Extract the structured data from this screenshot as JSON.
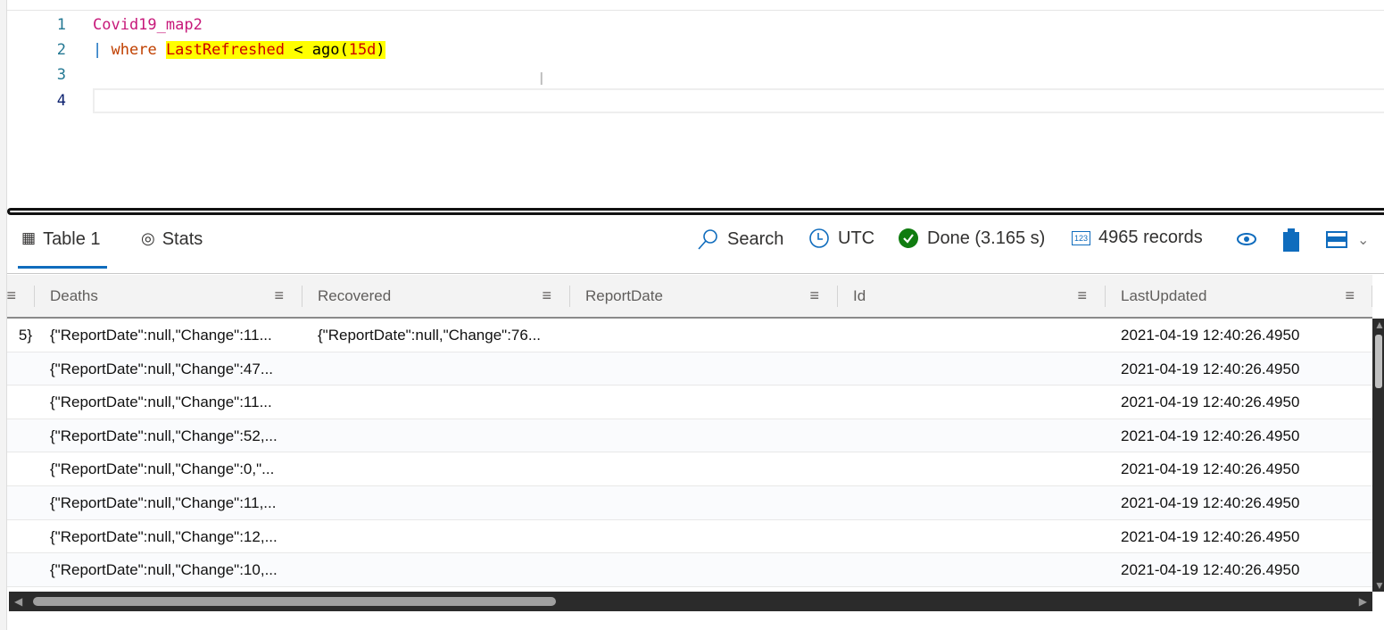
{
  "editor": {
    "lines": [
      {
        "number": "1",
        "table": "Covid19_map2"
      },
      {
        "number": "2",
        "pipe": "|",
        "keyword": "where",
        "column": "LastRefreshed",
        "op": "<",
        "func": "ago(",
        "arg": "15d",
        "close": ")"
      },
      {
        "number": "3"
      },
      {
        "number": "4"
      }
    ]
  },
  "results": {
    "tabs": [
      {
        "label": "Table 1",
        "icon": "table-icon"
      },
      {
        "label": "Stats",
        "icon": "stats-icon"
      }
    ],
    "toolbar": {
      "search": "Search",
      "timezone": "UTC",
      "status": "Done (3.165 s)",
      "records": "4965 records",
      "records_icon_text": "123"
    },
    "colors": {
      "accent": "#0f6cbd",
      "done": "#107c10",
      "highlight": "#ffff00"
    },
    "columns": [
      "Deaths",
      "Recovered",
      "ReportDate",
      "Id",
      "LastUpdated"
    ],
    "rows": [
      {
        "partial": "5}",
        "Deaths": "{\"ReportDate\":null,\"Change\":11...",
        "Recovered": "{\"ReportDate\":null,\"Change\":76...",
        "ReportDate": "",
        "Id": "",
        "LastUpdated": "2021-04-19 12:40:26.4950"
      },
      {
        "partial": "",
        "Deaths": "{\"ReportDate\":null,\"Change\":47...",
        "Recovered": "",
        "ReportDate": "",
        "Id": "",
        "LastUpdated": "2021-04-19 12:40:26.4950"
      },
      {
        "partial": "",
        "Deaths": "{\"ReportDate\":null,\"Change\":11...",
        "Recovered": "",
        "ReportDate": "",
        "Id": "",
        "LastUpdated": "2021-04-19 12:40:26.4950"
      },
      {
        "partial": "",
        "Deaths": "{\"ReportDate\":null,\"Change\":52,...",
        "Recovered": "",
        "ReportDate": "",
        "Id": "",
        "LastUpdated": "2021-04-19 12:40:26.4950"
      },
      {
        "partial": "",
        "Deaths": "{\"ReportDate\":null,\"Change\":0,\"...",
        "Recovered": "",
        "ReportDate": "",
        "Id": "",
        "LastUpdated": "2021-04-19 12:40:26.4950"
      },
      {
        "partial": "",
        "Deaths": "{\"ReportDate\":null,\"Change\":11,...",
        "Recovered": "",
        "ReportDate": "",
        "Id": "",
        "LastUpdated": "2021-04-19 12:40:26.4950"
      },
      {
        "partial": "",
        "Deaths": "{\"ReportDate\":null,\"Change\":12,...",
        "Recovered": "",
        "ReportDate": "",
        "Id": "",
        "LastUpdated": "2021-04-19 12:40:26.4950"
      },
      {
        "partial": "",
        "Deaths": "{\"ReportDate\":null,\"Change\":10,...",
        "Recovered": "",
        "ReportDate": "",
        "Id": "",
        "LastUpdated": "2021-04-19 12:40:26.4950"
      }
    ]
  }
}
